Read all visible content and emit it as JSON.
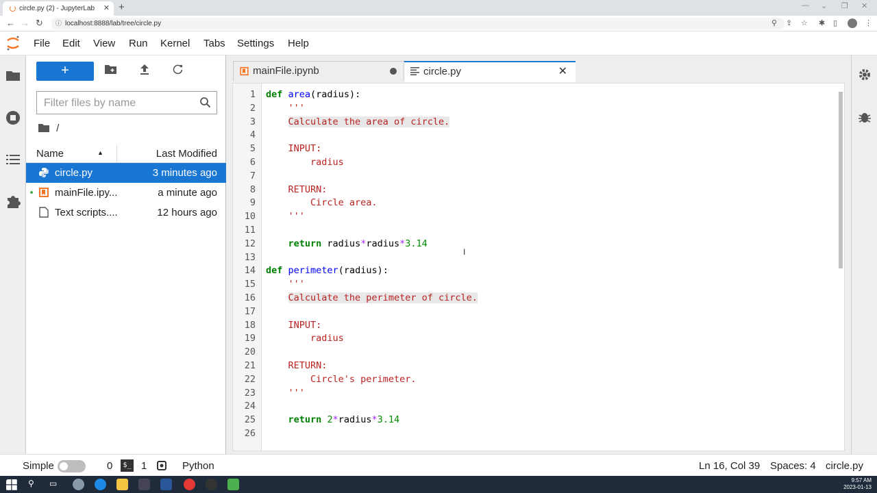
{
  "browser": {
    "tab_title": "circle.py (2) - JupyterLab",
    "url": "localhost:8888/lab/tree/circle.py"
  },
  "menu": [
    "File",
    "Edit",
    "View",
    "Run",
    "Kernel",
    "Tabs",
    "Settings",
    "Help"
  ],
  "filebrowser": {
    "new_label": "+",
    "filter_placeholder": "Filter files by name",
    "breadcrumb": "/",
    "col_name": "Name",
    "col_modified": "Last Modified",
    "files": [
      {
        "name": "circle.py",
        "modified": "3 minutes ago",
        "type": "python",
        "selected": true
      },
      {
        "name": "mainFile.ipy...",
        "modified": "a minute ago",
        "type": "notebook",
        "running": true
      },
      {
        "name": "Text scripts....",
        "modified": "12 hours ago",
        "type": "text"
      }
    ]
  },
  "tabs": [
    {
      "label": "mainFile.ipynb",
      "dirty": true
    },
    {
      "label": "circle.py",
      "active": true
    }
  ],
  "code_lines": [
    "def area(radius):",
    "    '''",
    "    Calculate the area of circle.",
    "",
    "    INPUT:",
    "        radius",
    "",
    "    RETURN:",
    "        Circle area.",
    "    '''",
    "",
    "    return radius*radius*3.14",
    "",
    "def perimeter(radius):",
    "    '''",
    "    Calculate the perimeter of circle.",
    "",
    "    INPUT:",
    "        radius",
    "",
    "    RETURN:",
    "        Circle's perimeter.",
    "    '''",
    "",
    "    return 2*radius*3.14",
    ""
  ],
  "status": {
    "mode": "Simple",
    "terminals": "0",
    "kernels": "1",
    "language": "Python",
    "cursor": "Ln 16, Col 39",
    "spaces": "Spaces: 4",
    "filename": "circle.py"
  },
  "taskbar": {
    "time": "9:57 AM",
    "date": "2023-01-13"
  }
}
